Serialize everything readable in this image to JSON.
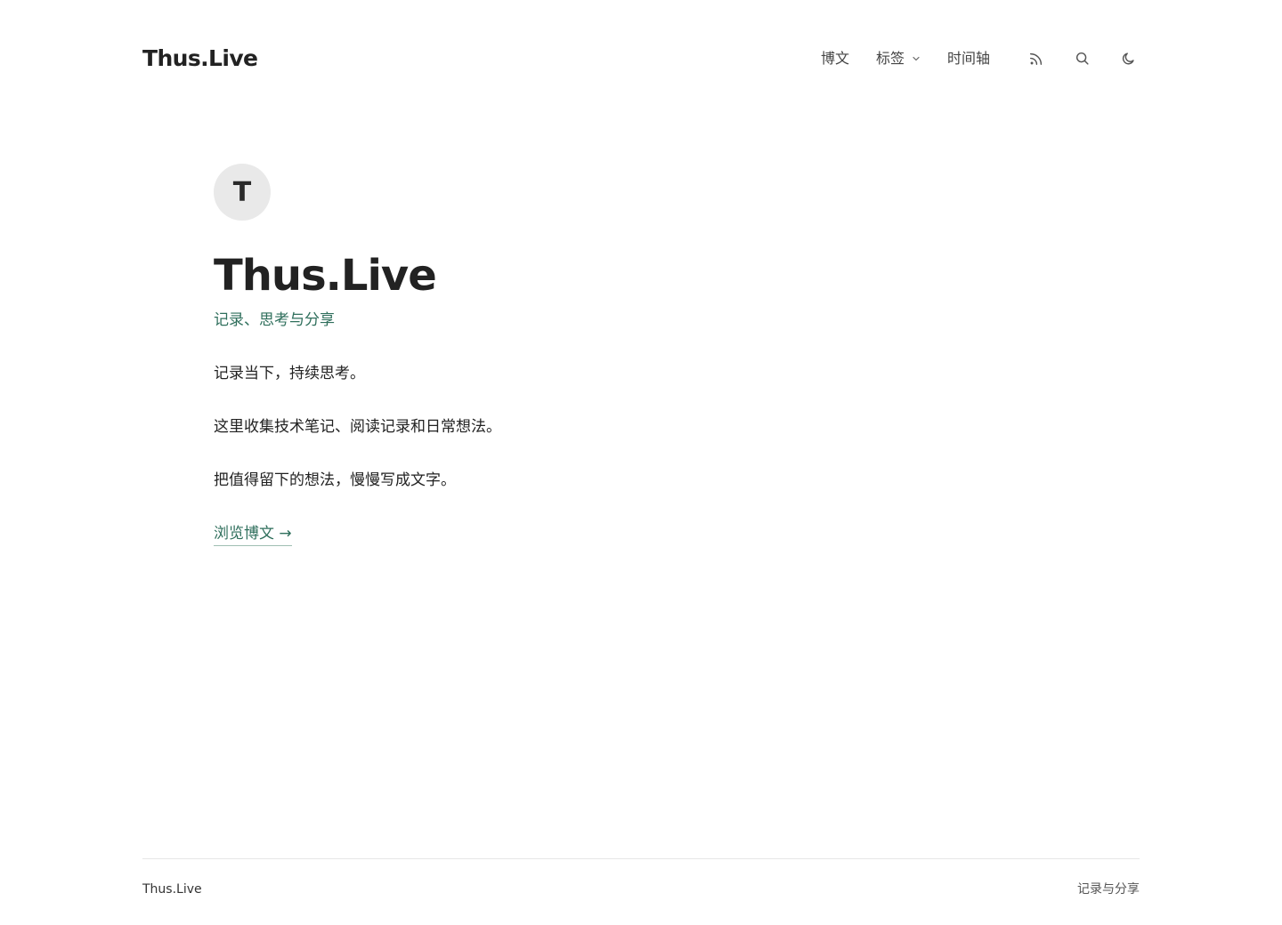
{
  "header": {
    "brand": "Thus.Live",
    "nav": {
      "posts": "博文",
      "tags": "标签",
      "timeline": "时间轴"
    },
    "icons": {
      "rss": "rss-icon",
      "search": "search-icon",
      "theme": "moon-icon",
      "dropdown": "chevron-down-icon"
    }
  },
  "hero": {
    "avatar_letter": "T",
    "title": "Thus.Live",
    "tagline": "记录、思考与分享",
    "paragraphs": [
      "记录当下，持续思考。",
      "这里收集技术笔记、阅读记录和日常想法。",
      "把值得留下的想法，慢慢写成文字。"
    ],
    "cta": "浏览博文 →"
  },
  "footer": {
    "left": "Thus.Live",
    "right": "记录与分享"
  },
  "colors": {
    "accent": "#2f6f5c",
    "text": "#222222",
    "avatar_bg": "#e9e9e9",
    "divider": "#e6e6e6"
  }
}
